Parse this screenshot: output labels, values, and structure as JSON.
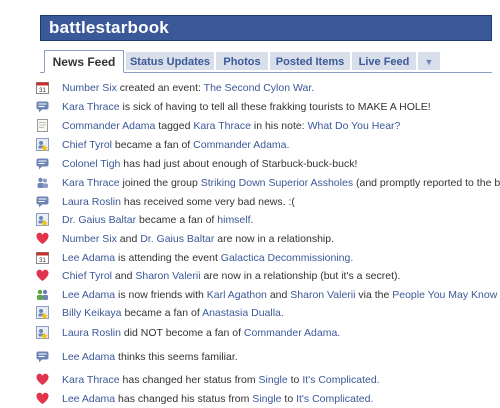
{
  "app": {
    "title": "battlestarbook"
  },
  "tabs": [
    {
      "label": "News Feed",
      "active": true
    },
    {
      "label": "Status Updates"
    },
    {
      "label": "Photos"
    },
    {
      "label": "Posted Items"
    },
    {
      "label": "Live Feed"
    }
  ],
  "colors": {
    "brand": "#3b5998",
    "tab_bg": "#d8dfea",
    "link": "#3b5998",
    "heart": "#e2344d"
  },
  "feed": [
    {
      "icon": "calendar-icon",
      "parts": [
        {
          "t": "Number Six",
          "link": true
        },
        {
          "t": " created an event: "
        },
        {
          "t": "The Second Cylon War.",
          "link": true
        }
      ]
    },
    {
      "icon": "status-icon",
      "parts": [
        {
          "t": "Kara Thrace",
          "link": true
        },
        {
          "t": " is sick of having to tell all these frakking tourists to MAKE A HOLE!"
        }
      ]
    },
    {
      "icon": "note-icon",
      "parts": [
        {
          "t": "Commander Adama",
          "link": true
        },
        {
          "t": " tagged "
        },
        {
          "t": "Kara Thrace",
          "link": true
        },
        {
          "t": " in his note: "
        },
        {
          "t": "What Do You Hear?",
          "link": true
        }
      ]
    },
    {
      "icon": "fan-icon",
      "parts": [
        {
          "t": "Chief Tyrol",
          "link": true
        },
        {
          "t": " became a fan of "
        },
        {
          "t": "Commander Adama.",
          "link": true
        }
      ]
    },
    {
      "icon": "status-icon",
      "parts": [
        {
          "t": "Colonel Tigh",
          "link": true
        },
        {
          "t": " has had just about enough of Starbuck-buck-buck!"
        }
      ]
    },
    {
      "icon": "group-icon",
      "parts": [
        {
          "t": "Kara Thrace",
          "link": true
        },
        {
          "t": " joined the group "
        },
        {
          "t": "Striking Down Superior Assholes",
          "link": true
        },
        {
          "t": " (and promptly reported to the brig)."
        }
      ]
    },
    {
      "icon": "status-icon",
      "parts": [
        {
          "t": "Laura Roslin",
          "link": true
        },
        {
          "t": " has received some very bad news.  :("
        }
      ]
    },
    {
      "icon": "fan-icon",
      "parts": [
        {
          "t": "Dr. Gaius Baltar",
          "link": true
        },
        {
          "t": " became a fan of "
        },
        {
          "t": "himself",
          "link": true
        },
        {
          "t": "."
        }
      ]
    },
    {
      "icon": "heart-icon",
      "parts": [
        {
          "t": "Number Six",
          "link": true
        },
        {
          "t": " and "
        },
        {
          "t": "Dr. Gaius Baltar",
          "link": true
        },
        {
          "t": " are now in a relationship."
        }
      ]
    },
    {
      "icon": "calendar-icon",
      "parts": [
        {
          "t": "Lee Adama",
          "link": true
        },
        {
          "t": " is attending the event "
        },
        {
          "t": "Galactica Decommissioning.",
          "link": true
        }
      ]
    },
    {
      "icon": "heart-icon",
      "parts": [
        {
          "t": "Chief Tyrol",
          "link": true
        },
        {
          "t": " and "
        },
        {
          "t": "Sharon Valerii",
          "link": true
        },
        {
          "t": " are now in a relationship (but it's a secret)."
        }
      ]
    },
    {
      "icon": "friends-icon",
      "parts": [
        {
          "t": "Lee Adama",
          "link": true
        },
        {
          "t": " is now friends with "
        },
        {
          "t": "Karl Agathon",
          "link": true
        },
        {
          "t": " and "
        },
        {
          "t": "Sharon Valerii",
          "link": true
        },
        {
          "t": " via the "
        },
        {
          "t": "People You May Know",
          "link": true
        },
        {
          "t": " tool."
        }
      ]
    },
    {
      "icon": "fan-icon",
      "parts": [
        {
          "t": "Billy Keikaya",
          "link": true
        },
        {
          "t": " became a fan of "
        },
        {
          "t": "Anastasia Dualla.",
          "link": true
        }
      ]
    },
    {
      "icon": "fan-icon",
      "parts": [
        {
          "t": "Laura Roslin",
          "link": true
        },
        {
          "t": " did NOT become a fan of "
        },
        {
          "t": "Commander Adama.",
          "link": true
        }
      ]
    },
    {
      "icon": "status-icon",
      "parts": [
        {
          "t": "Lee Adama",
          "link": true
        },
        {
          "t": " thinks this seems familiar."
        }
      ]
    },
    {
      "icon": "heart-icon",
      "parts": [
        {
          "t": "Kara Thrace",
          "link": true
        },
        {
          "t": " has changed her status from "
        },
        {
          "t": "Single",
          "link": true
        },
        {
          "t": " to "
        },
        {
          "t": "It's Complicated.",
          "link": true
        }
      ]
    },
    {
      "icon": "heart-icon",
      "parts": [
        {
          "t": "Lee Adama",
          "link": true
        },
        {
          "t": " has changed his status from "
        },
        {
          "t": "Single",
          "link": true
        },
        {
          "t": " to "
        },
        {
          "t": "It's Complicated.",
          "link": true
        }
      ]
    }
  ]
}
